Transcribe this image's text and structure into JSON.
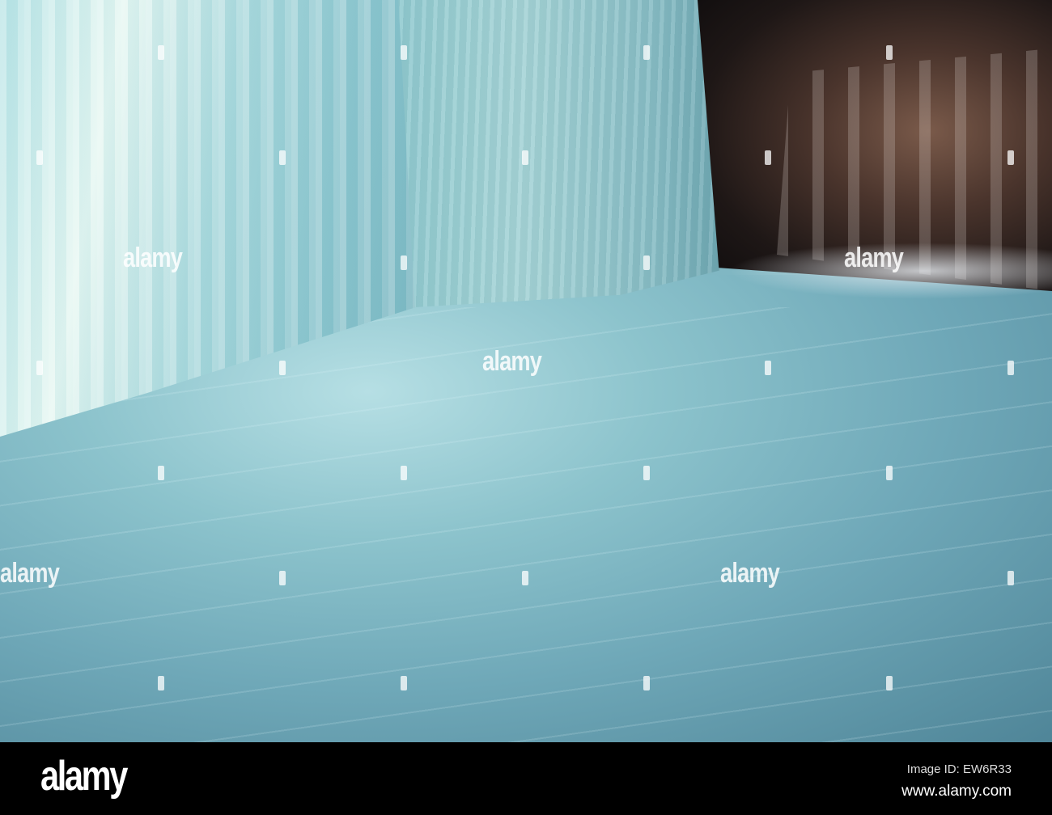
{
  "photo": {
    "description_alt": "Ice cave"
  },
  "watermark": {
    "text": "alamy"
  },
  "footer": {
    "logo": "alamy",
    "image_id": "Image ID: EW6R33",
    "url": "www.alamy.com"
  }
}
